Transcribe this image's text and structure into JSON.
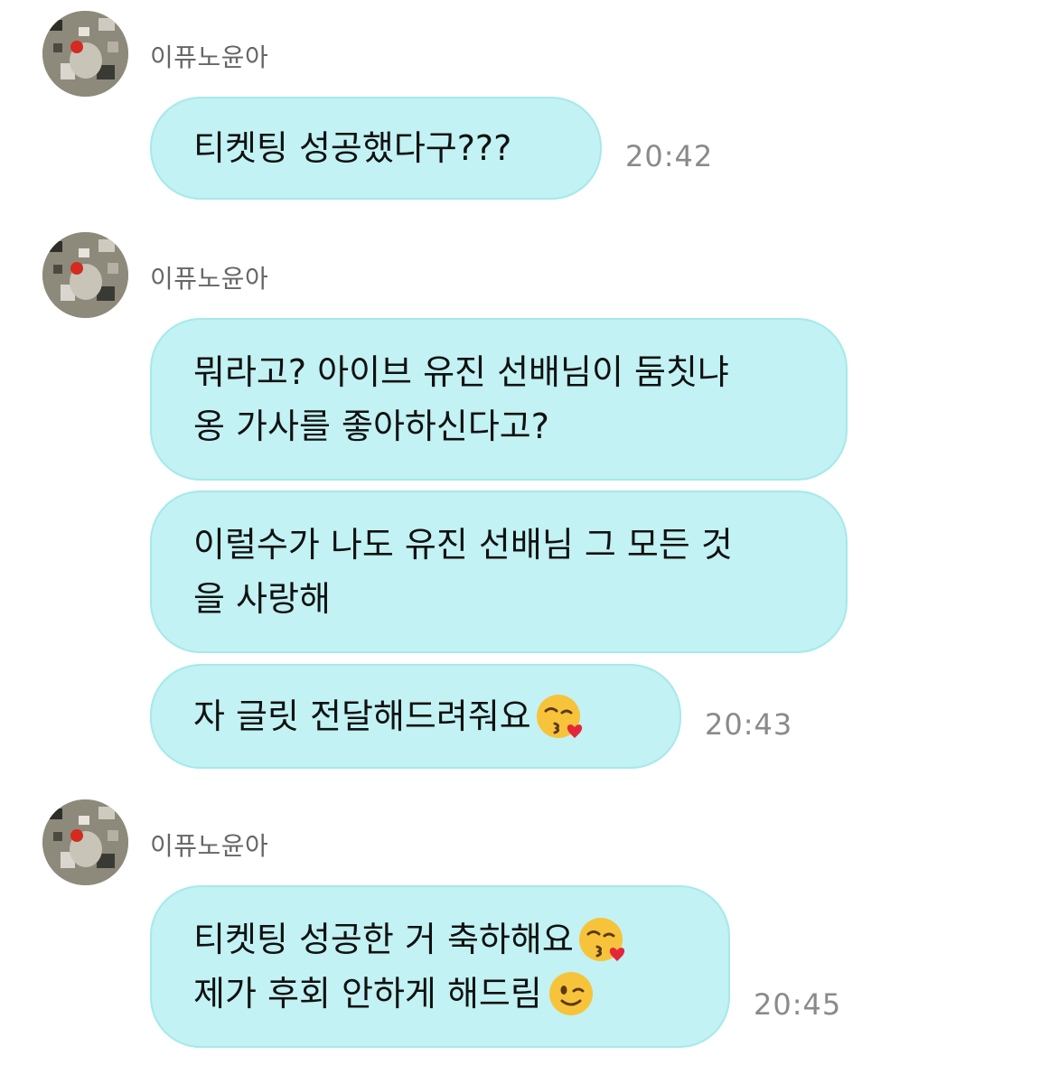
{
  "conversation": {
    "groups": [
      {
        "sender": "이퓨노윤아",
        "messages": [
          {
            "lines": [
              "티켓팅 성공했다구???"
            ],
            "time": "20:42"
          }
        ]
      },
      {
        "sender": "이퓨노윤아",
        "messages": [
          {
            "lines": [
              "뭐라고? 아이브 유진 선배님이 둠칫냐",
              "옹 가사를 좋아하신다고?"
            ]
          },
          {
            "lines": [
              "이럴수가 나도 유진 선배님 그 모든 것",
              "을 사랑해"
            ]
          },
          {
            "lines": [
              "자 글릿 전달해드려줘요"
            ],
            "emoji": "kissing-face-with-heart-icon",
            "time": "20:43"
          }
        ]
      },
      {
        "sender": "이퓨노윤아",
        "messages": [
          {
            "lines": [
              "티켓팅 성공한 거 축하해요",
              "제가 후회 안하게 해드림"
            ],
            "emojis": [
              "kissing-face-with-heart-icon",
              "winking-face-icon"
            ],
            "time": "20:45"
          }
        ]
      }
    ]
  },
  "colors": {
    "bubble_bg": "#c2f2f3",
    "bubble_border": "#a5e9eb",
    "sender_text": "#666666",
    "time_text": "#8a8a8a"
  }
}
